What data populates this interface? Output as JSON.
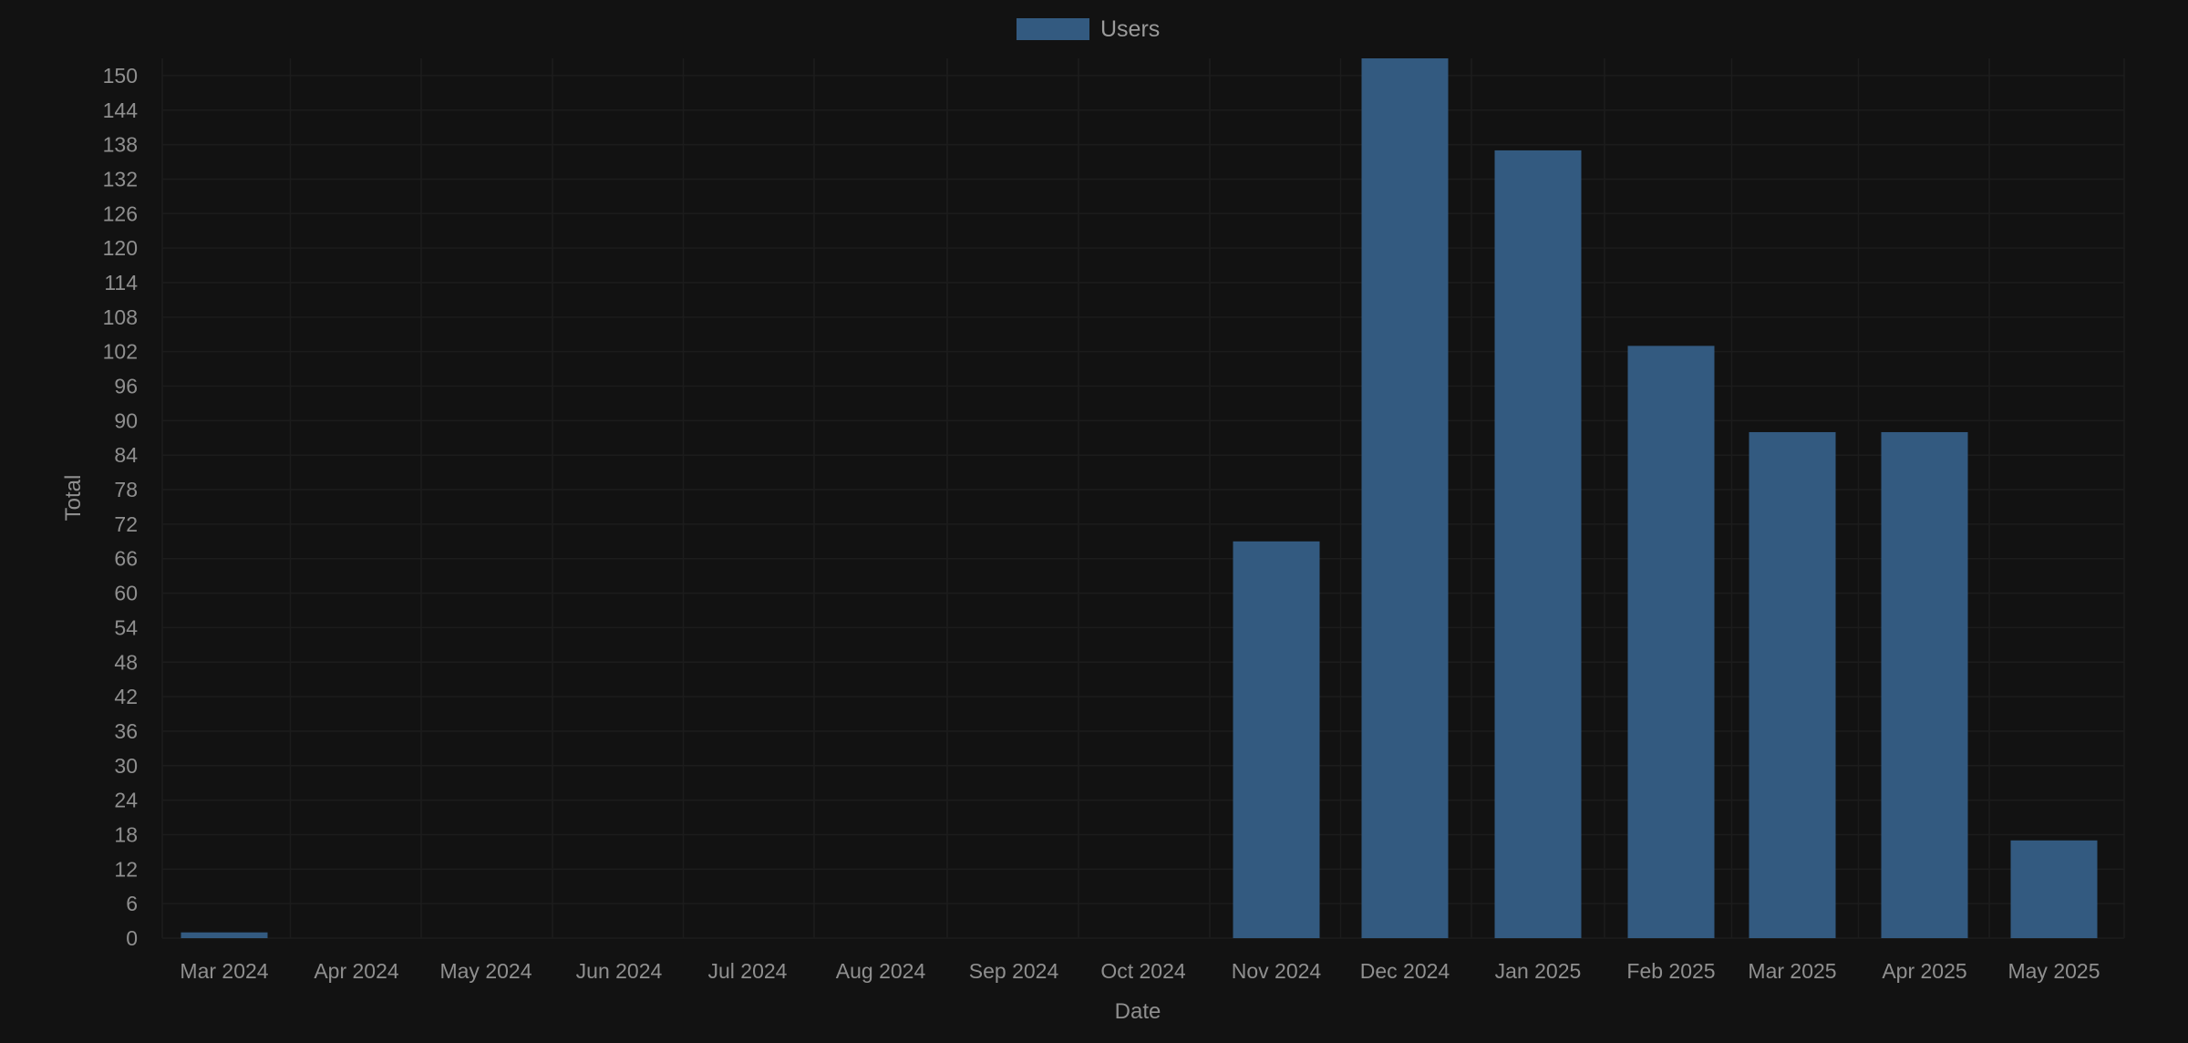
{
  "chart_data": {
    "type": "bar",
    "categories": [
      "Mar 2024",
      "Apr 2024",
      "May 2024",
      "Jun 2024",
      "Jul 2024",
      "Aug 2024",
      "Sep 2024",
      "Oct 2024",
      "Nov 2024",
      "Dec 2024",
      "Jan 2025",
      "Feb 2025",
      "Mar 2025",
      "Apr 2025",
      "May 2025"
    ],
    "series": [
      {
        "name": "Users",
        "values": [
          1,
          0,
          0,
          0,
          0,
          0,
          0,
          0,
          69,
          153,
          137,
          103,
          88,
          88,
          17
        ]
      }
    ],
    "xlabel": "Date",
    "ylabel": "Total",
    "ylim": [
      0,
      153
    ],
    "yticks": [
      0,
      6,
      12,
      18,
      24,
      30,
      36,
      42,
      48,
      54,
      60,
      66,
      72,
      78,
      84,
      90,
      96,
      102,
      108,
      114,
      120,
      126,
      132,
      138,
      144,
      150
    ],
    "grid": true,
    "legend": "top-center",
    "colors": {
      "background": "#121212",
      "bar": "#335a80",
      "text": "#8f8f8f",
      "grid": "#1c1c1c"
    }
  }
}
